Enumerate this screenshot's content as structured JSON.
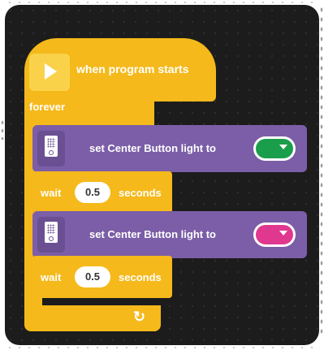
{
  "hat": {
    "label": "when program starts",
    "icon": "play-icon"
  },
  "forever": {
    "label": "forever",
    "icon": "loop-arrow-icon"
  },
  "blocks": [
    {
      "type": "set-light",
      "label": "set Center Button light to",
      "color": "#1b9e4b",
      "icon": "hub-brick-icon"
    },
    {
      "type": "wait",
      "label_pre": "wait",
      "value": "0.5",
      "label_post": "seconds"
    },
    {
      "type": "set-light",
      "label": "set Center Button light to",
      "color": "#e0378f",
      "icon": "hub-brick-icon"
    },
    {
      "type": "wait",
      "label_pre": "wait",
      "value": "0.5",
      "label_post": "seconds"
    }
  ],
  "colors": {
    "events": "#f5b91b",
    "light": "#7b5ea7",
    "canvas": "#1c1c1c"
  }
}
